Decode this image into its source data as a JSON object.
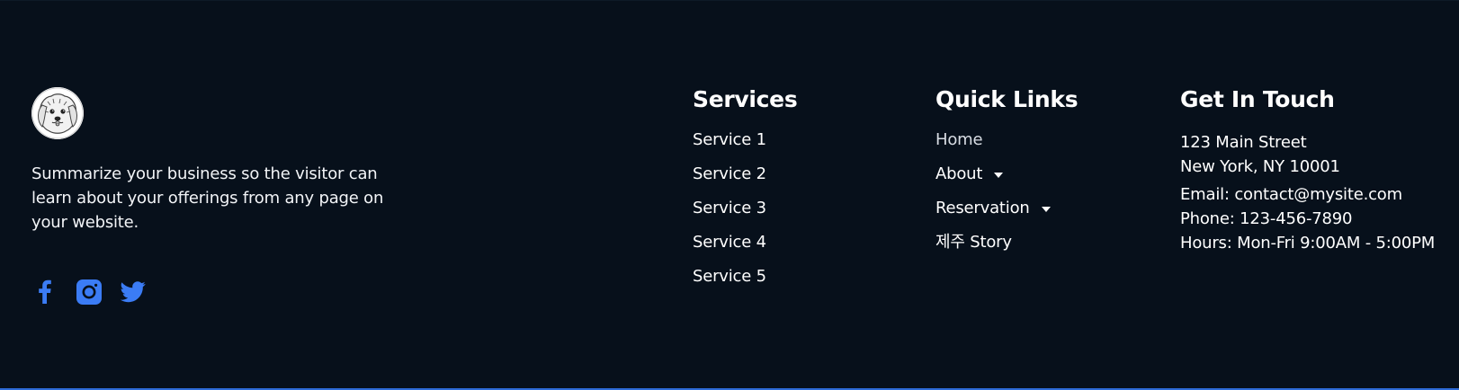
{
  "brand": {
    "logo_icon": "dog-sketch-logo",
    "summary": "Summarize your business so the visitor can learn about your offerings from any page on your website."
  },
  "social": [
    {
      "icon": "facebook-icon",
      "color": "#3b7cf5"
    },
    {
      "icon": "instagram-icon",
      "color": "#3b7cf5"
    },
    {
      "icon": "twitter-icon",
      "color": "#3b7cf5"
    }
  ],
  "services": {
    "title": "Services",
    "items": [
      "Service 1",
      "Service 2",
      "Service 3",
      "Service 4",
      "Service 5"
    ]
  },
  "quick_links": {
    "title": "Quick Links",
    "items": [
      {
        "label": "Home",
        "has_dropdown": false
      },
      {
        "label": "About",
        "has_dropdown": true
      },
      {
        "label": "Reservation",
        "has_dropdown": true
      },
      {
        "label": "제주 Story",
        "has_dropdown": false
      }
    ]
  },
  "contact": {
    "title": "Get In Touch",
    "address_line1": "123 Main Street",
    "address_line2": "New York, NY 10001",
    "email": "Email: contact@mysite.com",
    "phone": "Phone: 123-456-7890",
    "hours": "Hours: Mon-Fri 9:00AM - 5:00PM"
  },
  "colors": {
    "background": "#07101b",
    "accent": "#3b7cf5",
    "bottom_border": "#2d6bd7"
  }
}
